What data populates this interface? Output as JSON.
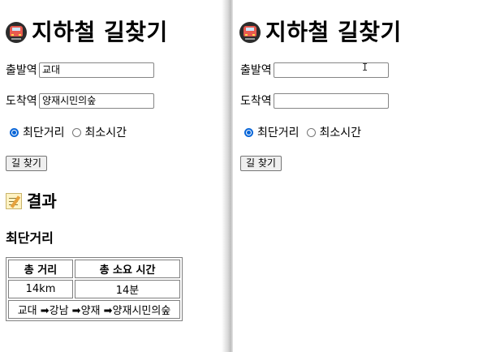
{
  "left": {
    "title": "지하철 길찾기",
    "form": {
      "departure_label": "출발역",
      "departure_value": "교대",
      "arrival_label": "도착역",
      "arrival_value": "양재시민의숲",
      "option_shortest_distance": "최단거리",
      "option_min_time": "최소시간",
      "selected_option": "최단거리",
      "search_button": "길 찾기"
    },
    "result": {
      "heading": "결과",
      "subheading": "최단거리",
      "table": {
        "headers": [
          "총 거리",
          "총 소요 시간"
        ],
        "values": [
          "14km",
          "14분"
        ],
        "path": "교대 ➡강남 ➡양재 ➡양재시민의숲"
      }
    }
  },
  "right": {
    "title": "지하철 길찾기",
    "form": {
      "departure_label": "출발역",
      "departure_value": "",
      "arrival_label": "도착역",
      "arrival_value": "",
      "option_shortest_distance": "최단거리",
      "option_min_time": "최소시간",
      "selected_option": "최단거리",
      "search_button": "길 찾기"
    }
  },
  "icons": {
    "title_icon": "metro-icon",
    "result_icon": "memo-icon"
  },
  "colors": {
    "radio_accent": "#0a66d8"
  }
}
